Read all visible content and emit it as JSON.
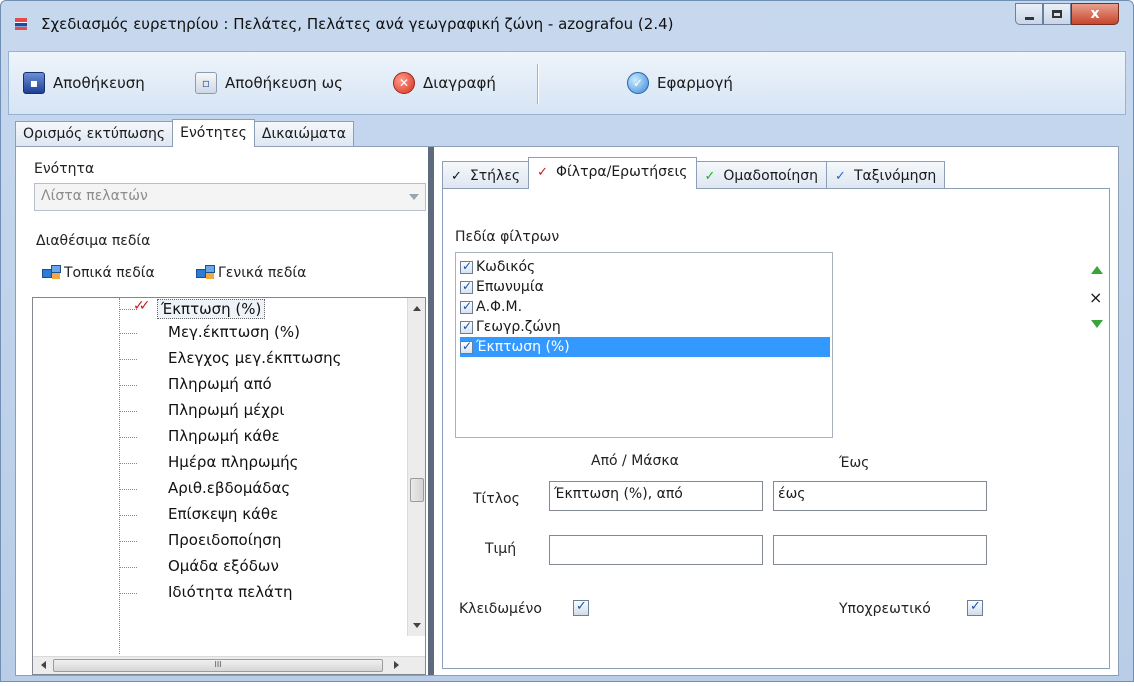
{
  "window": {
    "logo": "S1",
    "title": "Σχεδιασμός ευρετηρίου : Πελάτες, Πελάτες ανά γεωγραφική ζώνη - azografou (2.4)",
    "close_label": "x"
  },
  "toolbar": {
    "save_label": "Αποθήκευση",
    "saveas_label": "Αποθήκευση ως",
    "delete_label": "Διαγραφή",
    "apply_label": "Εφαρμογή"
  },
  "main_tabs": [
    "Ορισμός εκτύπωσης",
    "Ενότητες",
    "Δικαιώματα"
  ],
  "main_tab_active": 1,
  "left": {
    "section_label": "Ενότητα",
    "section_value": "Λίστα πελατών",
    "available_fields_label": "Διαθέσιμα πεδία",
    "local_fields_label": "Τοπικά πεδία",
    "general_fields_label": "Γενικά πεδία",
    "tree_items": [
      "Έκπτωση (%)",
      "Μεγ.έκπτωση (%)",
      "Ελεγχος μεγ.έκπτωσης",
      "Πληρωμή από",
      "Πληρωμή μέχρι",
      "Πληρωμή κάθε",
      "Ημέρα πληρωμής",
      "Αριθ.εβδομάδας",
      "Επίσκεψη κάθε",
      "Προειδοποίηση",
      "Ομάδα εξόδων",
      "Ιδιότητα πελάτη"
    ],
    "tree_selected_index": 0,
    "hscroll_grip": "III"
  },
  "right": {
    "sub_tabs": [
      {
        "label": "Στήλες",
        "check_color": "#111111"
      },
      {
        "label": "Φίλτρα/Ερωτήσεις",
        "check_color": "#d11a1a"
      },
      {
        "label": "Ομαδοποίηση",
        "check_color": "#1bb31b"
      },
      {
        "label": "Ταξινόμηση",
        "check_color": "#2a66d1"
      }
    ],
    "sub_tab_active": 1,
    "filter_fields_label": "Πεδία φίλτρων",
    "filter_fields": [
      "Κωδικός",
      "Επωνυμία",
      "Α.Φ.Μ.",
      "Γεωγρ.ζώνη",
      "Έκπτωση (%)"
    ],
    "filter_selected_index": 4,
    "from_mask_label": "Από / Μάσκα",
    "to_label": "Έως",
    "title_label": "Τίτλος",
    "title_from_value": "Έκπτωση (%), από",
    "title_to_value": "έως",
    "value_label": "Τιμή",
    "value_from": "",
    "value_to": "",
    "locked_label": "Κλειδωμένο",
    "required_label": "Υποχρεωτικό",
    "remove_glyph": "×"
  },
  "colors": {
    "selection": "#3399ff",
    "frame": "#b9cde8"
  }
}
